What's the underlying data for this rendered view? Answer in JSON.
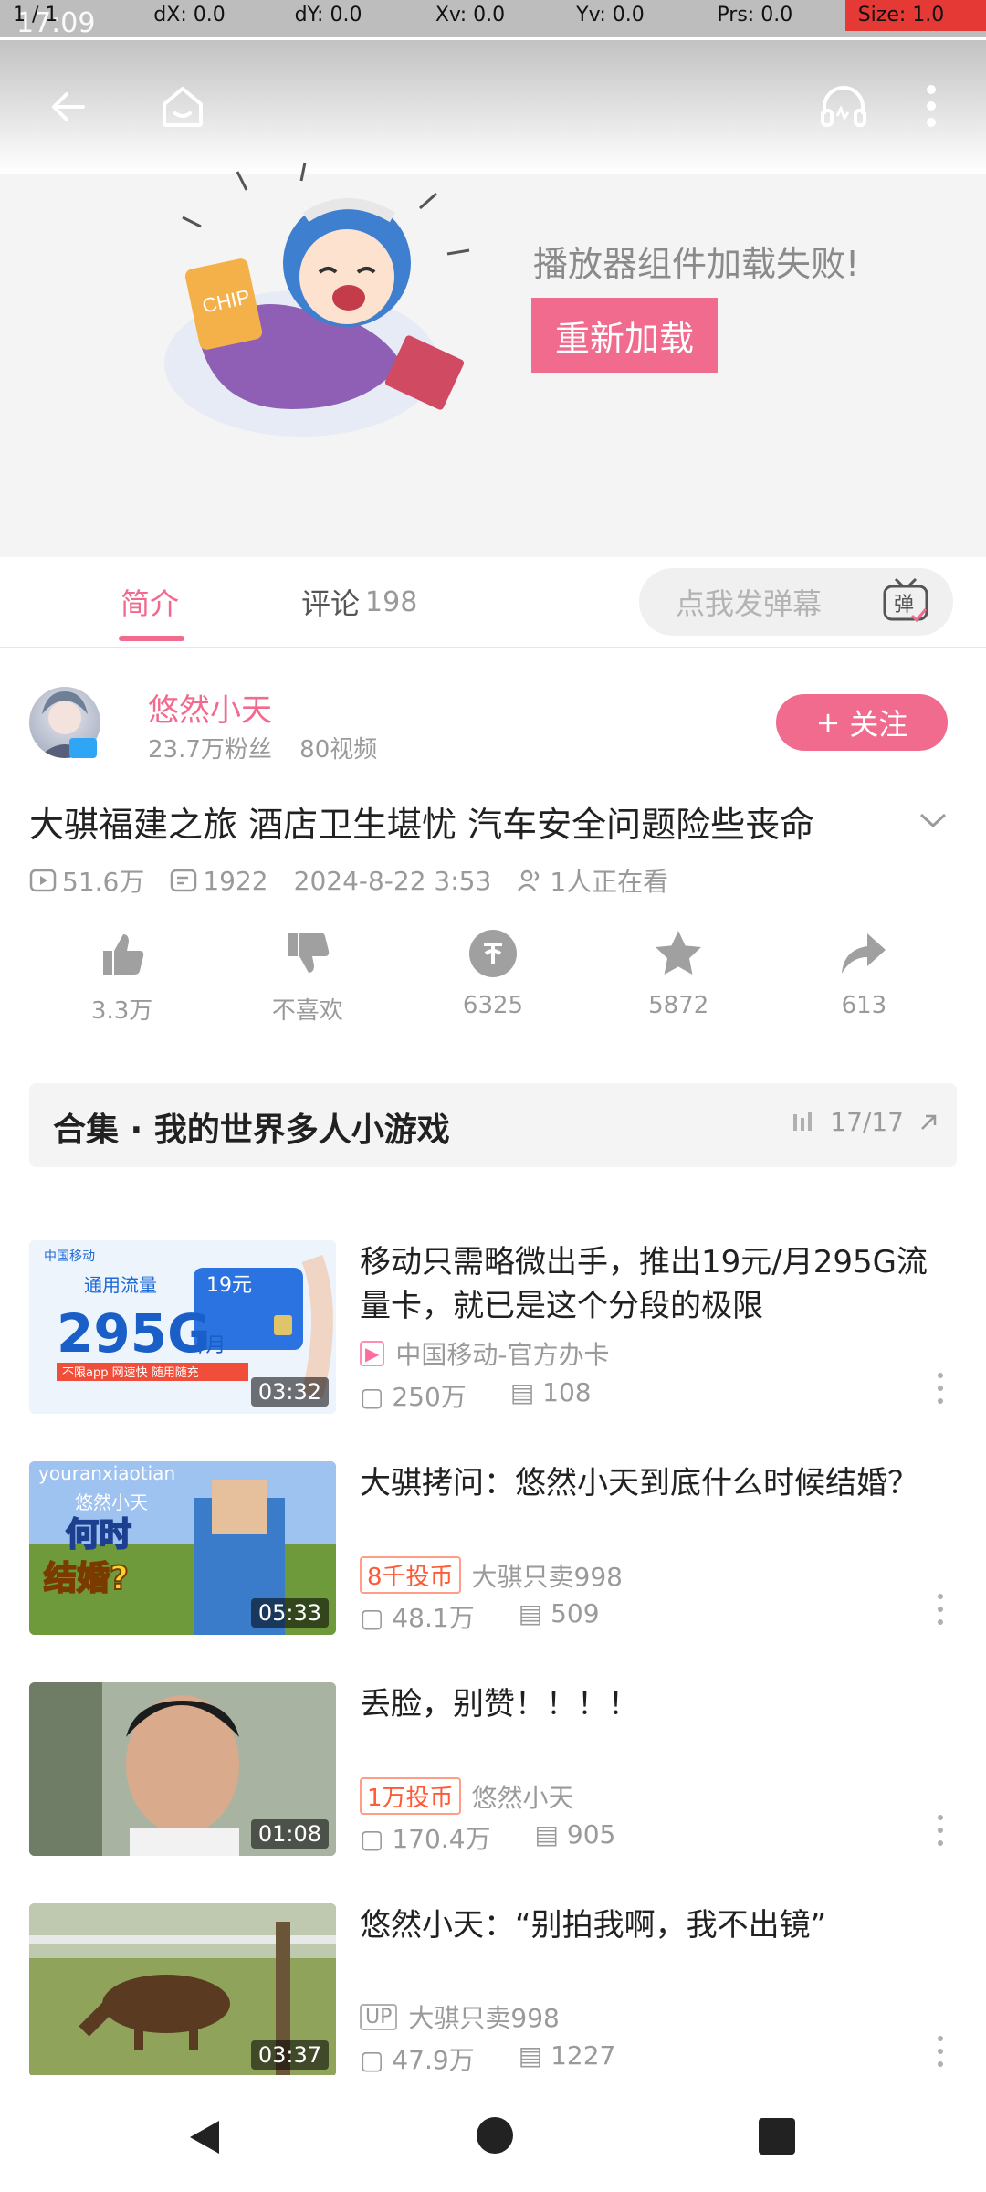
{
  "status_bar": {
    "clock": "17:09",
    "debug": [
      "1 / 1",
      "dX: 0.0",
      "dY: 0.0",
      "Xv: 0.0",
      "Yv: 0.0",
      "Prs: 0.0",
      "Size: 1.0"
    ]
  },
  "player": {
    "error_text": "播放器组件加载失败!",
    "reload_label": "重新加载"
  },
  "tabs": {
    "intro": "简介",
    "comments": "评论",
    "comments_count": "198",
    "danmu_placeholder": "点我发弹幕",
    "danmu_button": "弹"
  },
  "uploader": {
    "name": "悠然小天",
    "fans": "23.7万粉丝",
    "videos": "80视频",
    "follow_label": "关注",
    "follow_plus": "+"
  },
  "video": {
    "title": "大骐福建之旅 酒店卫生堪忧 汽车安全问题险些丧命",
    "views": "51.6万",
    "danmaku": "1922",
    "date": "2024-8-22 3:53",
    "watching": "1人正在看"
  },
  "actions": [
    {
      "icon": "thumb-up-icon",
      "label": "3.3万"
    },
    {
      "icon": "thumb-down-icon",
      "label": "不喜欢"
    },
    {
      "icon": "coin-icon",
      "label": "6325"
    },
    {
      "icon": "star-icon",
      "label": "5872"
    },
    {
      "icon": "share-icon",
      "label": "613"
    }
  ],
  "collection": {
    "title": "合集 · 我的世界多人小游戏",
    "progress": "17/17"
  },
  "recommended": [
    {
      "title": "移动只需略微出手，推出19元/月295G流量卡，就已是这个分段的极限",
      "badge": "",
      "author": "中国移动-官方办卡",
      "duration": "03:32",
      "views": "250万",
      "danmaku": "108",
      "thumb_color": "#e9f1fb"
    },
    {
      "title": "大骐拷问：悠然小天到底什么时候结婚？",
      "badge": "8千投币",
      "author": "大骐只卖998",
      "duration": "05:33",
      "views": "48.1万",
      "danmaku": "509",
      "thumb_color": "#6b8fc7"
    },
    {
      "title": "丢脸，别赞！！！！",
      "badge": "1万投币",
      "author": "悠然小天",
      "duration": "01:08",
      "views": "170.4万",
      "danmaku": "905",
      "thumb_color": "#7d8b7a"
    },
    {
      "title": "悠然小天：“别拍我啊，我不出镜”",
      "badge": "",
      "author": "大骐只卖998",
      "duration": "03:37",
      "views": "47.9万",
      "danmaku": "1227",
      "thumb_color": "#7c8a4e"
    }
  ],
  "thumb_texts": {
    "card_brand": "中国移动",
    "card_flow": "通用流量",
    "card_price": "19元",
    "card_big": "295G",
    "card_unit": "/月",
    "card_tags": "不限app  网速快  随用随充",
    "game_top": "youranxiaotian",
    "game_name": "悠然小天",
    "game_q1": "何时",
    "game_q2": "结婚?"
  },
  "colors": {
    "accent": "#f06b8e",
    "secondary_text": "#9a9a9a",
    "coin_badge": "#ff5a36"
  }
}
